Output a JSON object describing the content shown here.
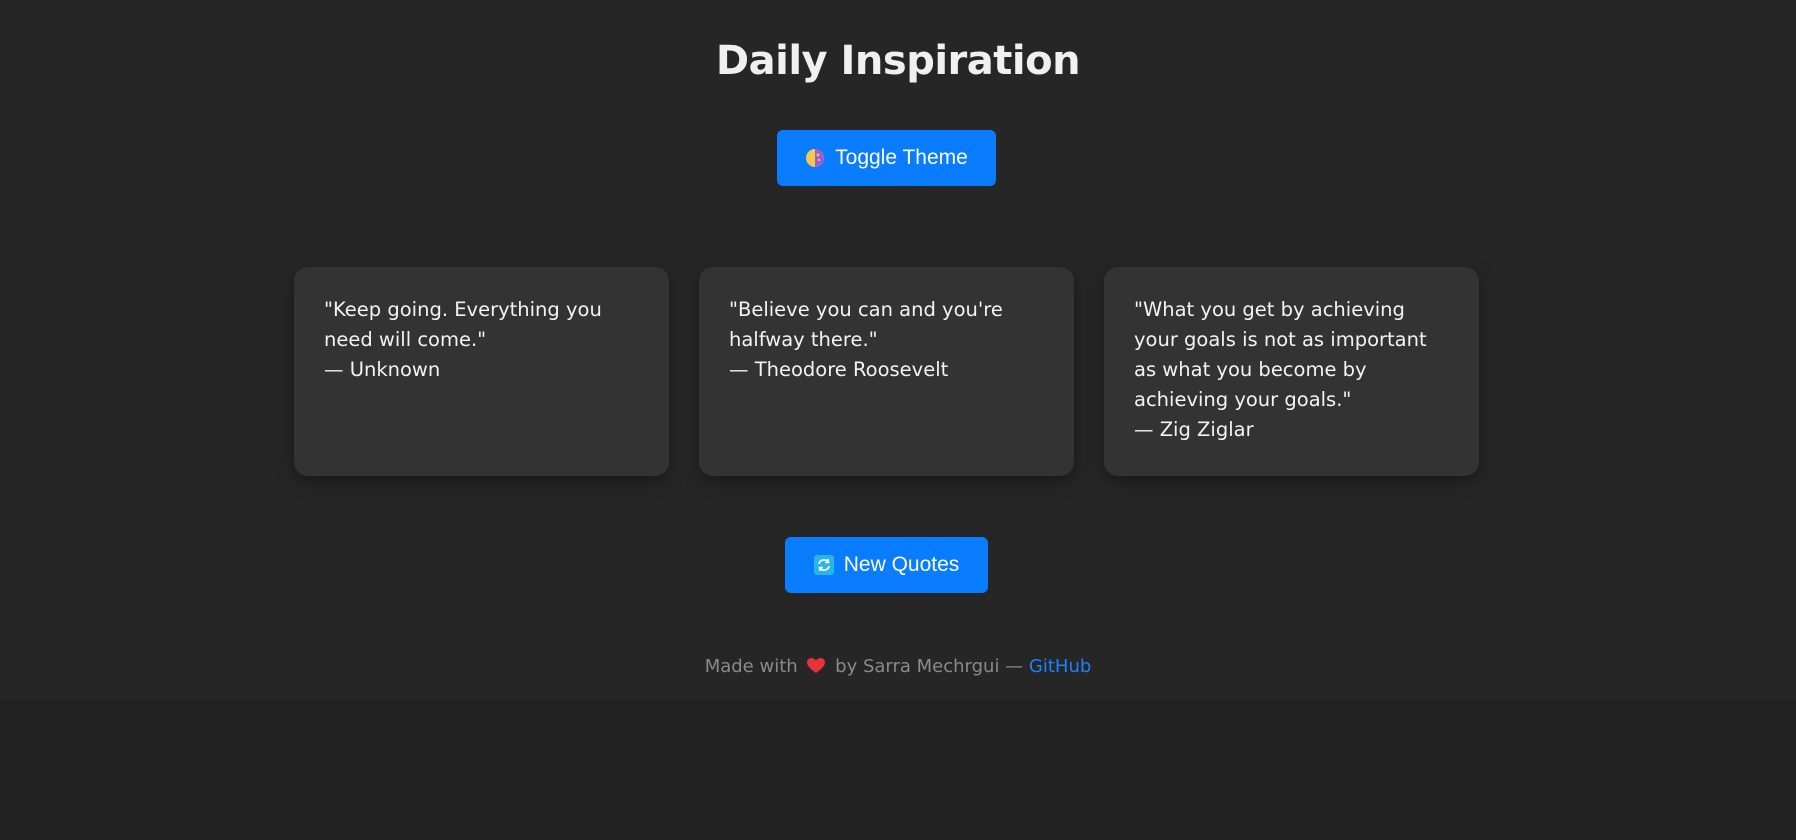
{
  "header": {
    "title": "Daily Inspiration"
  },
  "toggle_button": {
    "icon": "theme-icon",
    "label": "Toggle Theme"
  },
  "quotes": [
    {
      "text": "\"Keep going. Everything you need will come.\"",
      "author": "— Unknown"
    },
    {
      "text": "\"Believe you can and you're halfway there.\"",
      "author": "— Theodore Roosevelt"
    },
    {
      "text": "\"What you get by achieving your goals is not as important as what you become by achieving your goals.\"",
      "author": "— Zig Ziglar"
    }
  ],
  "new_quotes_button": {
    "icon": "refresh-icon",
    "label": "New Quotes"
  },
  "footer": {
    "made_with": "Made with",
    "heart_icon": "heart-icon",
    "by_text": "by Sarra Mechrgui —",
    "github_label": "GitHub"
  },
  "colors": {
    "background": "#262626",
    "card": "#333333",
    "accent": "#0a7cff",
    "link": "#1b82ff",
    "footer_text": "#8a8a8a"
  }
}
